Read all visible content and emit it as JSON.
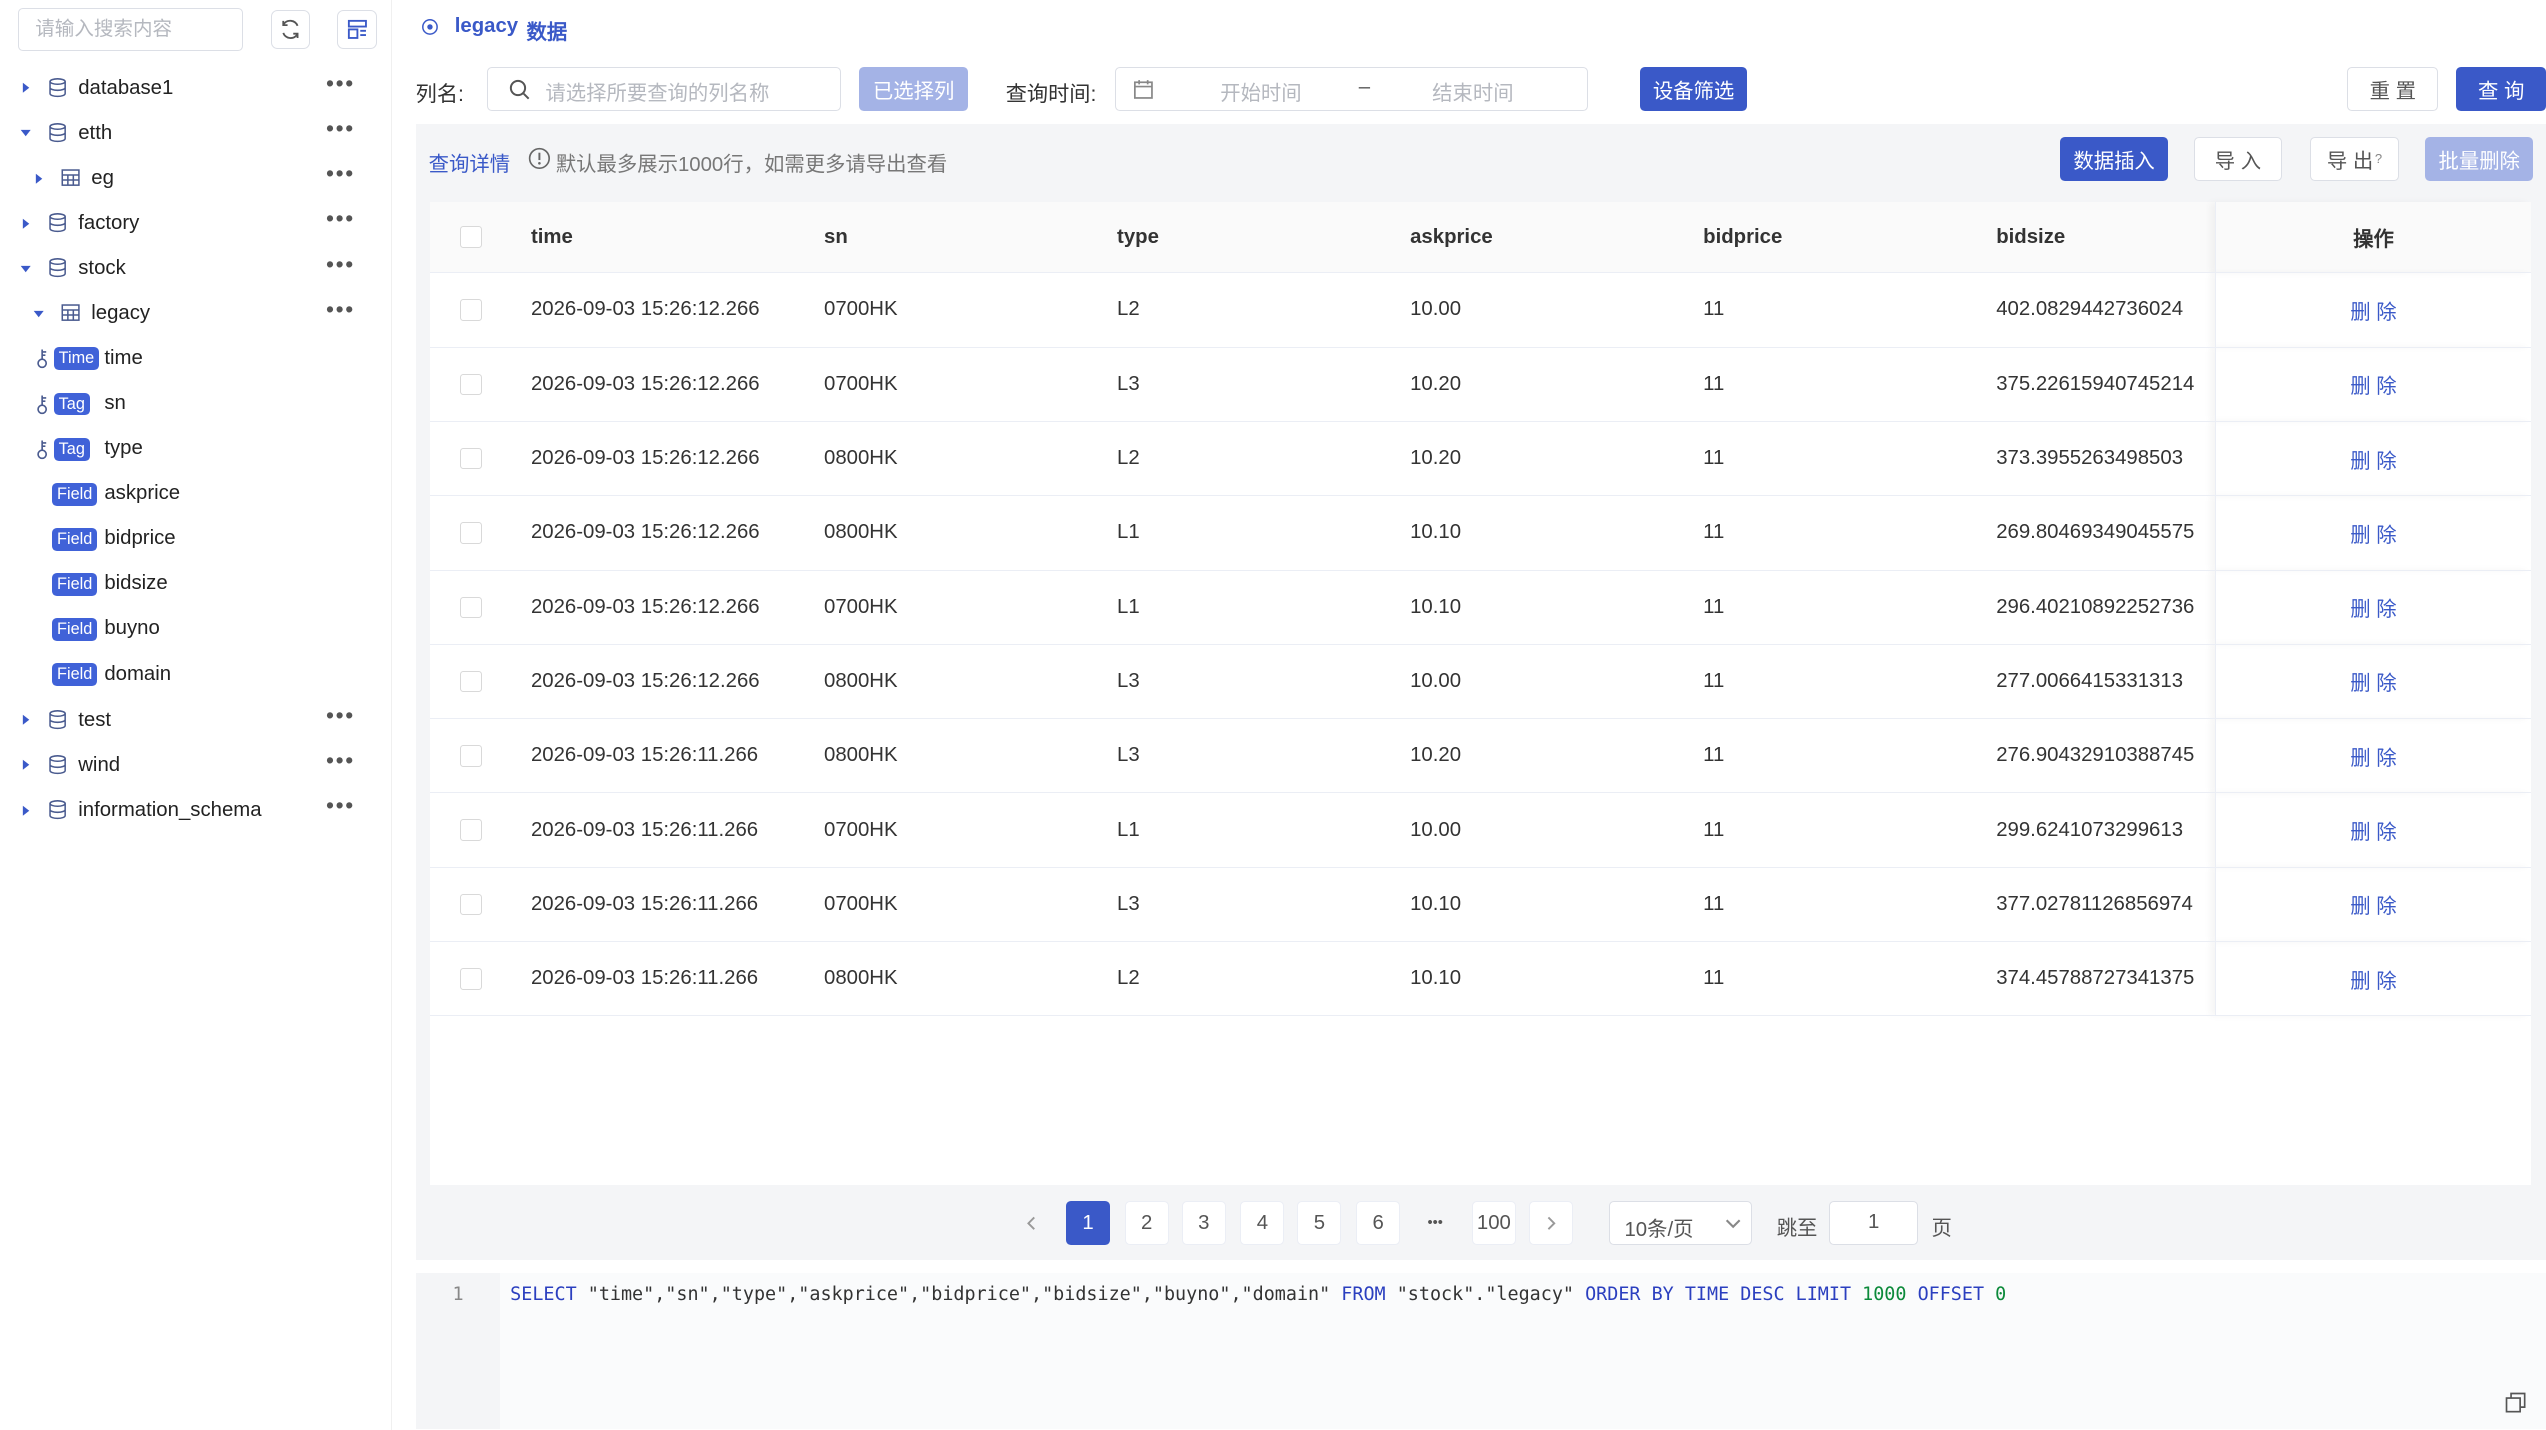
{
  "sidebar": {
    "search_placeholder": "请输入搜索内容",
    "tree": [
      {
        "label": "database1",
        "kind": "database",
        "expanded": false
      },
      {
        "label": "etth",
        "kind": "database",
        "expanded": true
      },
      {
        "label": "eg",
        "kind": "table",
        "expanded": false
      },
      {
        "label": "factory",
        "kind": "database",
        "expanded": false
      },
      {
        "label": "stock",
        "kind": "database",
        "expanded": true
      },
      {
        "label": "legacy",
        "kind": "table",
        "expanded": true
      },
      {
        "label": "time",
        "kind": "column",
        "badge": "Time",
        "key": true
      },
      {
        "label": "sn",
        "kind": "column",
        "badge": "Tag",
        "key": true
      },
      {
        "label": "type",
        "kind": "column",
        "badge": "Tag",
        "key": true
      },
      {
        "label": "askprice",
        "kind": "column",
        "badge": "Field"
      },
      {
        "label": "bidprice",
        "kind": "column",
        "badge": "Field"
      },
      {
        "label": "bidsize",
        "kind": "column",
        "badge": "Field"
      },
      {
        "label": "buyno",
        "kind": "column",
        "badge": "Field"
      },
      {
        "label": "domain",
        "kind": "column",
        "badge": "Field"
      },
      {
        "label": "test",
        "kind": "database",
        "expanded": false
      },
      {
        "label": "wind",
        "kind": "database",
        "expanded": false
      },
      {
        "label": "information_schema",
        "kind": "database",
        "expanded": false
      }
    ]
  },
  "title": {
    "table": "legacy",
    "suffix": "数据"
  },
  "filters": {
    "column_label": "列名:",
    "column_placeholder": "请选择所要查询的列名称",
    "selected_columns_button": "已选择列",
    "time_label": "查询时间:",
    "start_placeholder": "开始时间",
    "range_separator": "–",
    "end_placeholder": "结束时间",
    "device_filter_button": "设备筛选",
    "reset_button": "重 置",
    "query_button": "查 询"
  },
  "toolbar": {
    "details_label": "查询详情",
    "info_text": "默认最多展示1000行，如需更多请导出查看",
    "insert_button": "数据插入",
    "import_button": "导 入",
    "export_button": "导 出",
    "export_help": "?",
    "batch_delete_button": "批量删除"
  },
  "table": {
    "columns": [
      "time",
      "sn",
      "type",
      "askprice",
      "bidprice",
      "bidsize"
    ],
    "op_header": "操作",
    "delete_label": "删 除",
    "rows": [
      [
        "2026-09-03 15:26:12.266",
        "0700HK",
        "L2",
        "10.00",
        "11",
        "402.0829442736024"
      ],
      [
        "2026-09-03 15:26:12.266",
        "0700HK",
        "L3",
        "10.20",
        "11",
        "375.22615940745214"
      ],
      [
        "2026-09-03 15:26:12.266",
        "0800HK",
        "L2",
        "10.20",
        "11",
        "373.3955263498503"
      ],
      [
        "2026-09-03 15:26:12.266",
        "0800HK",
        "L1",
        "10.10",
        "11",
        "269.80469349045575"
      ],
      [
        "2026-09-03 15:26:12.266",
        "0700HK",
        "L1",
        "10.10",
        "11",
        "296.40210892252736"
      ],
      [
        "2026-09-03 15:26:12.266",
        "0800HK",
        "L3",
        "10.00",
        "11",
        "277.0066415331313"
      ],
      [
        "2026-09-03 15:26:11.266",
        "0800HK",
        "L3",
        "10.20",
        "11",
        "276.90432910388745"
      ],
      [
        "2026-09-03 15:26:11.266",
        "0700HK",
        "L1",
        "10.00",
        "11",
        "299.6241073299613"
      ],
      [
        "2026-09-03 15:26:11.266",
        "0700HK",
        "L3",
        "10.10",
        "11",
        "377.02781126856974"
      ],
      [
        "2026-09-03 15:26:11.266",
        "0800HK",
        "L2",
        "10.10",
        "11",
        "374.45788727341375"
      ]
    ]
  },
  "pagination": {
    "pages": [
      "1",
      "2",
      "3",
      "4",
      "5",
      "6",
      "•••",
      "100"
    ],
    "current": "1",
    "page_size": "10条/页",
    "jump_label": "跳至",
    "jump_value": "1",
    "page_suffix": "页"
  },
  "sql": {
    "line_number": "1",
    "tokens": [
      {
        "t": "SELECT ",
        "c": "kw"
      },
      {
        "t": "\"time\",\"sn\",\"type\",\"askprice\",\"bidprice\",\"bidsize\",\"buyno\",\"domain\" ",
        "c": "str"
      },
      {
        "t": "FROM ",
        "c": "kw"
      },
      {
        "t": "\"stock\".\"legacy\" ",
        "c": "str"
      },
      {
        "t": "ORDER BY TIME DESC LIMIT ",
        "c": "kw"
      },
      {
        "t": "1000 ",
        "c": "num"
      },
      {
        "t": "OFFSET ",
        "c": "kw"
      },
      {
        "t": "0",
        "c": "num"
      }
    ]
  },
  "colors": {
    "accent": "#3a59c8",
    "accent_light": "#a4b3e6"
  }
}
